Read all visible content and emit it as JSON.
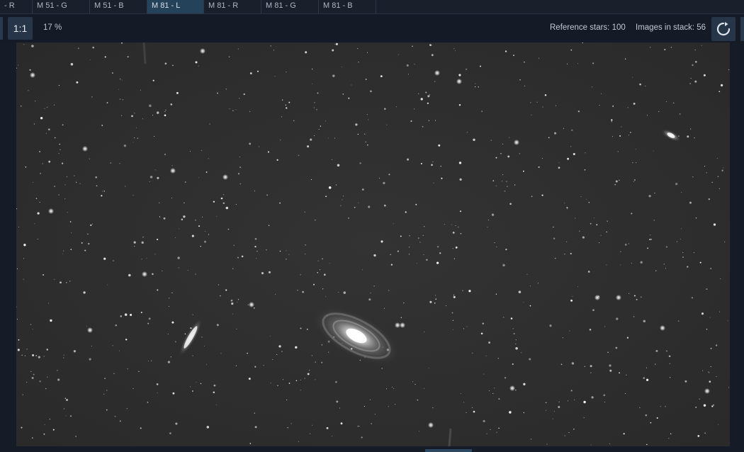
{
  "tabs": [
    {
      "label": "- R",
      "active": false
    },
    {
      "label": "M 51 - G",
      "active": false
    },
    {
      "label": "M 51 - B",
      "active": false
    },
    {
      "label": "M 81 - L",
      "active": true
    },
    {
      "label": "M 81 - R",
      "active": false
    },
    {
      "label": "M 81 - G",
      "active": false
    },
    {
      "label": "M 81 - B",
      "active": false
    }
  ],
  "toolbar": {
    "one_to_one_label": "1:1",
    "zoom_level": "17 %",
    "reference_stars": "Reference stars: 100",
    "images_in_stack": "Images in stack: 56",
    "refresh_icon": "refresh-icon"
  },
  "image": {
    "subject": "M 81 - L",
    "background_color": "#2f2f2f"
  },
  "colors": {
    "app_background": "#151b26",
    "active_tab": "#24425a",
    "button_background": "#263648"
  }
}
